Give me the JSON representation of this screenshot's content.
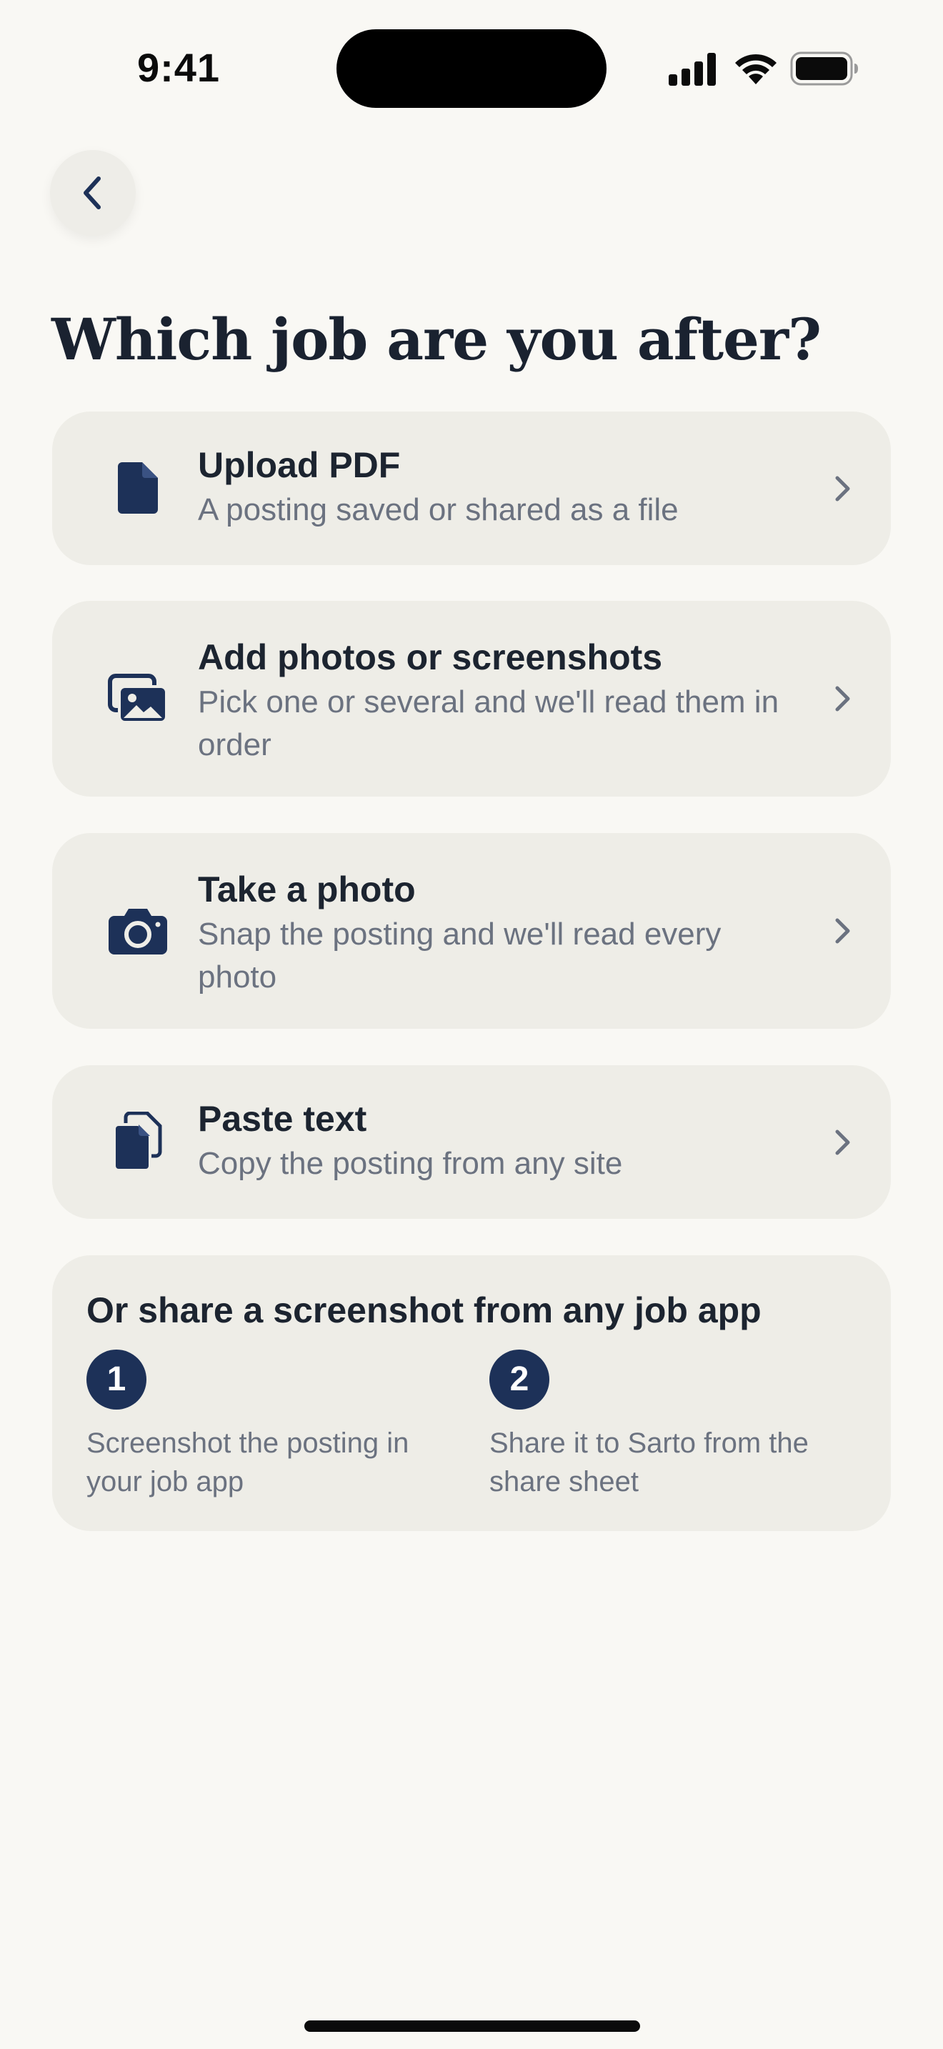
{
  "status_bar": {
    "time": "9:41"
  },
  "header": {
    "back_icon": "chevron-left-icon",
    "title": "Which job are you after?"
  },
  "options": [
    {
      "icon": "document-icon",
      "title": "Upload PDF",
      "subtitle": "A posting saved or shared as a file"
    },
    {
      "icon": "photo-stack-icon",
      "title": "Add photos or screenshots",
      "subtitle": "Pick one or several and we'll read them in order"
    },
    {
      "icon": "camera-icon",
      "title": "Take a photo",
      "subtitle": "Snap the posting and we'll read every photo"
    },
    {
      "icon": "paste-icon",
      "title": "Paste text",
      "subtitle": "Copy the posting from any site"
    }
  ],
  "share": {
    "title": "Or share a screenshot from any job app",
    "steps": [
      {
        "number": "1",
        "text": "Screenshot the posting in your job app"
      },
      {
        "number": "2",
        "text": "Share it to Sarto from the share sheet"
      }
    ]
  },
  "colors": {
    "background": "#f9f8f4",
    "card": "#eeede7",
    "accent": "#1d3158",
    "text": "#1c2430",
    "muted_text": "#6b7280"
  }
}
